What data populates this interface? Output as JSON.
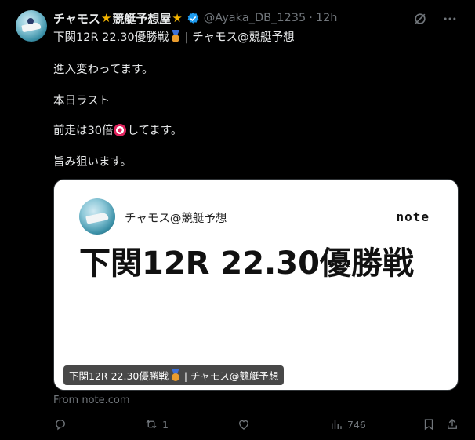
{
  "tweet": {
    "display_name": "チャモス",
    "name_suffix": "競艇予想屋",
    "handle": "@Ayaka_DB_1235",
    "separator": "·",
    "time": "12h",
    "title_line": "下関12R 22.30優勝戦",
    "title_after_medal": "| チャモス@競艇予想",
    "lines": [
      "進入変わってます。",
      "本日ラスト",
      "前走は30倍",
      "してます。",
      "旨み狙います。"
    ]
  },
  "card": {
    "author": "チャモス@競艇予想",
    "logo": "note",
    "headline": "下関12R 22.30優勝戦",
    "caption_pre": "下関12R 22.30優勝戦",
    "caption_post": "| チャモス@競艇予想",
    "source": "From note.com"
  },
  "actions": {
    "reply_count": "",
    "retweet_count": "1",
    "like_count": "",
    "views_count": "746"
  },
  "colors": {
    "background": "#000000",
    "text": "#e7e9ea",
    "muted": "#71767b",
    "verified": "#1d9bf0",
    "star": "#f4b400"
  }
}
